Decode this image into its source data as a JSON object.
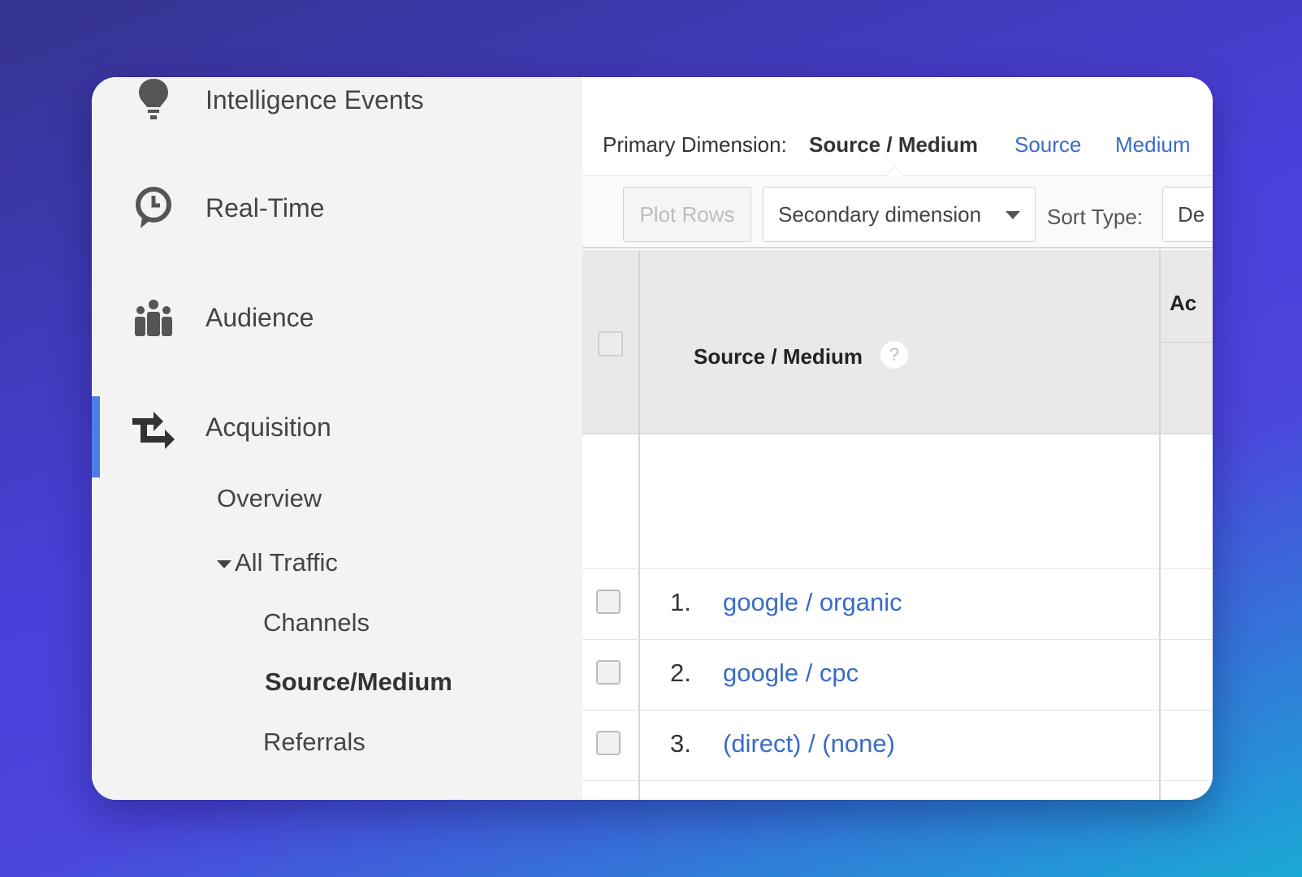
{
  "sidebar": {
    "items": [
      {
        "label": "Intelligence Events",
        "icon": "lightbulb-icon"
      },
      {
        "label": "Real-Time",
        "icon": "clock-icon"
      },
      {
        "label": "Audience",
        "icon": "people-icon"
      },
      {
        "label": "Acquisition",
        "icon": "acquisition-arrows-icon"
      }
    ],
    "sub_items": {
      "overview": "Overview",
      "all_traffic": "All Traffic",
      "channels": "Channels",
      "source_medium": "Source/Medium",
      "referrals": "Referrals"
    },
    "accent_color": "#4a7fe8"
  },
  "dimension_bar": {
    "label": "Primary Dimension:",
    "current": "Source / Medium",
    "options": [
      "Source",
      "Medium"
    ]
  },
  "toolbar": {
    "plot_rows_label": "Plot Rows",
    "secondary_dimension_label": "Secondary dimension",
    "sort_type_label": "Sort Type:",
    "sort_type_value": "De"
  },
  "table": {
    "column_header": "Source / Medium",
    "help_icon_text": "?",
    "next_column_header": "Ac",
    "rows": [
      {
        "num": "1.",
        "label": "google / organic"
      },
      {
        "num": "2.",
        "label": "google / cpc"
      },
      {
        "num": "3.",
        "label": "(direct) / (none)"
      }
    ],
    "link_color": "#3a6bc9"
  }
}
